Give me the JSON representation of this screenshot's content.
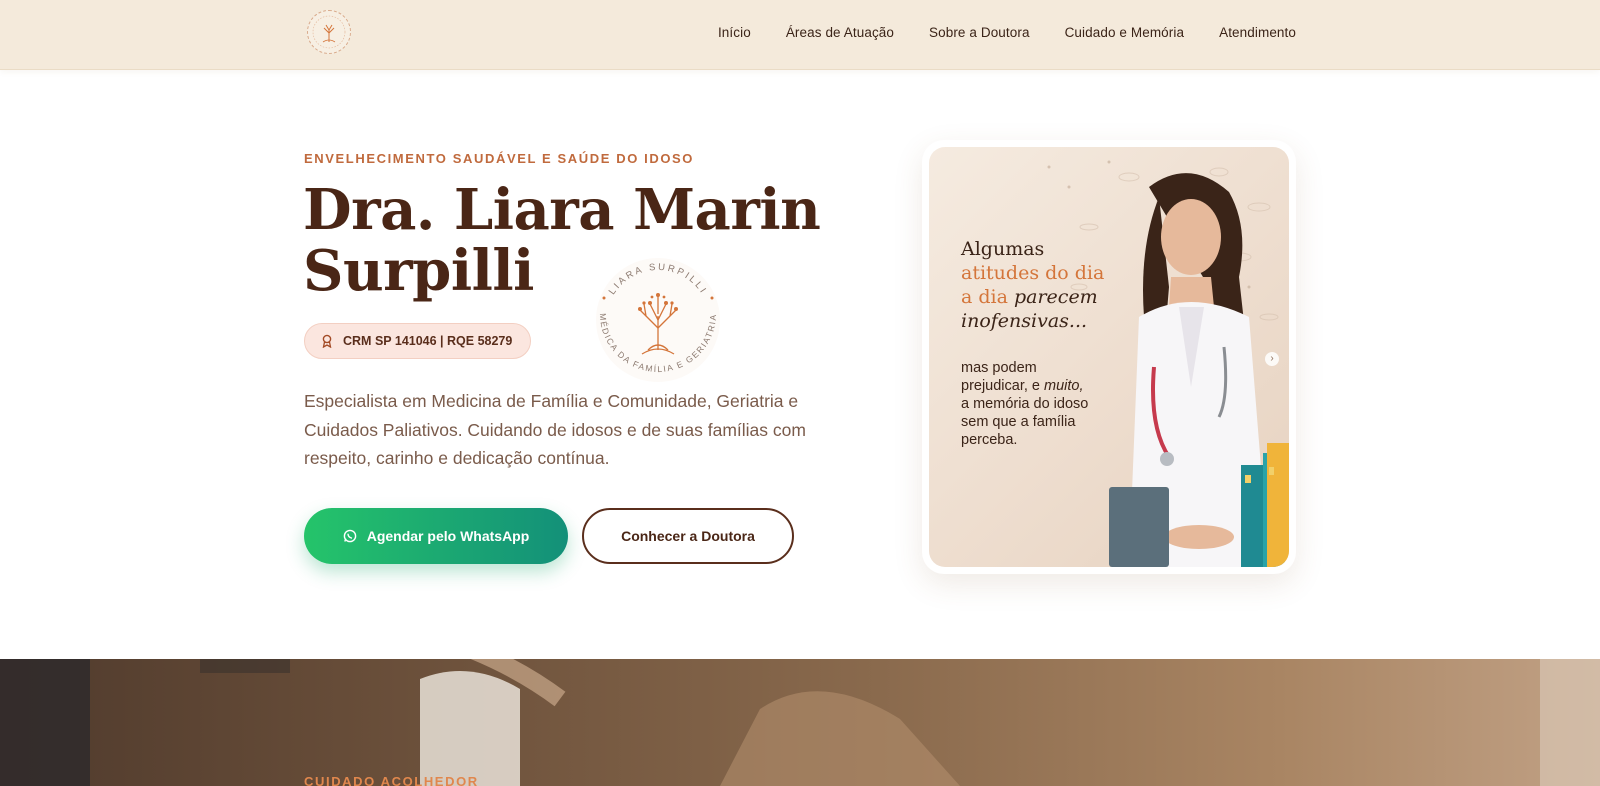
{
  "nav": {
    "logo_text": "LIARA SURPILLI MÉDICA DA FAMÍLIA E GERIATRIA",
    "links": [
      "Início",
      "Áreas de Atuação",
      "Sobre a Doutora",
      "Cuidado e Memória",
      "Atendimento"
    ]
  },
  "hero": {
    "eyebrow": "ENVELHECIMENTO SAUDÁVEL E SAÚDE DO IDOSO",
    "title_line1": "Dra. Liara Marin",
    "title_line2": "Surpilli",
    "badge": "CRM SP 141046 | RQE 58279",
    "seal_top": "LIARA SURPILLI",
    "seal_bottom": "MÉDICA DA FAMÍLIA E GERIATRIA",
    "description": "Especialista em Medicina de Família e Comunidade, Geriatria e Cuidados Paliativos. Cuidando de idosos e de suas famílias com respeito, carinho e dedicação contínua.",
    "primary_button": "Agendar pelo WhatsApp",
    "secondary_button": "Conhecer a Doutora"
  },
  "card": {
    "line1": "Algumas",
    "line2": "atitudes do dia",
    "line3": "a dia",
    "line3b": "parecem",
    "line4": "inofensivas...",
    "body1": "mas podem",
    "body2": "prejudicar, e",
    "body2b": "muito,",
    "body3": "a memória do idoso",
    "body4": "sem que a família",
    "body5": "perceba.",
    "arrow": "›"
  },
  "section2": {
    "eyebrow": "CUIDADO ACOLHEDOR"
  },
  "colors": {
    "nav_bg": "#f4eadb",
    "accent": "#c06a3d",
    "title": "#4a2616",
    "whatsapp_start": "#25c46a",
    "whatsapp_end": "#139079"
  }
}
